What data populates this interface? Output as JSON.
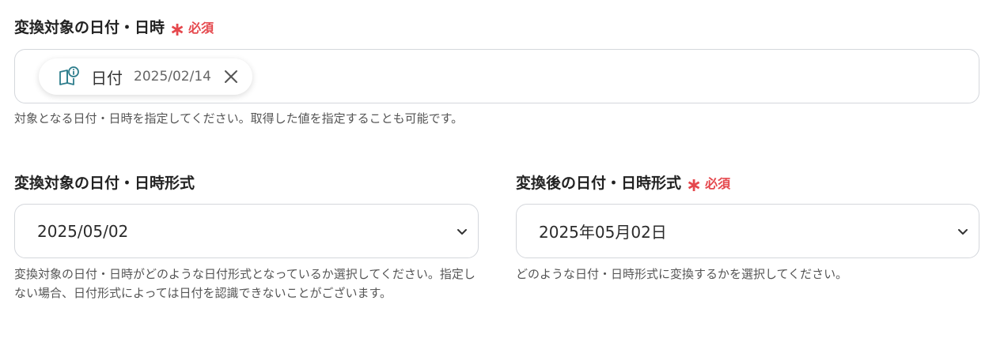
{
  "field_target_datetime": {
    "label": "変換対象の日付・日時",
    "required_mark": "∗",
    "required_text": "必須",
    "chip": {
      "name": "日付",
      "value": "2025/02/14",
      "icon": "book-info-icon"
    },
    "help": "対象となる日付・日時を指定してください。取得した値を指定することも可能です。"
  },
  "field_source_format": {
    "label": "変換対象の日付・日時形式",
    "selected": "2025/05/02",
    "help": "変換対象の日付・日時がどのような日付形式となっているか選択してください。指定しない場合、日付形式によっては日付を認識できないことがございます。"
  },
  "field_output_format": {
    "label": "変換後の日付・日時形式",
    "required_mark": "∗",
    "required_text": "必須",
    "selected": "2025年05月02日",
    "help": "どのような日付・日時形式に変換するかを選択してください。"
  },
  "colors": {
    "required": "#e5484d",
    "border": "#d4d7dc",
    "icon_teal": "#2d7d8c"
  }
}
